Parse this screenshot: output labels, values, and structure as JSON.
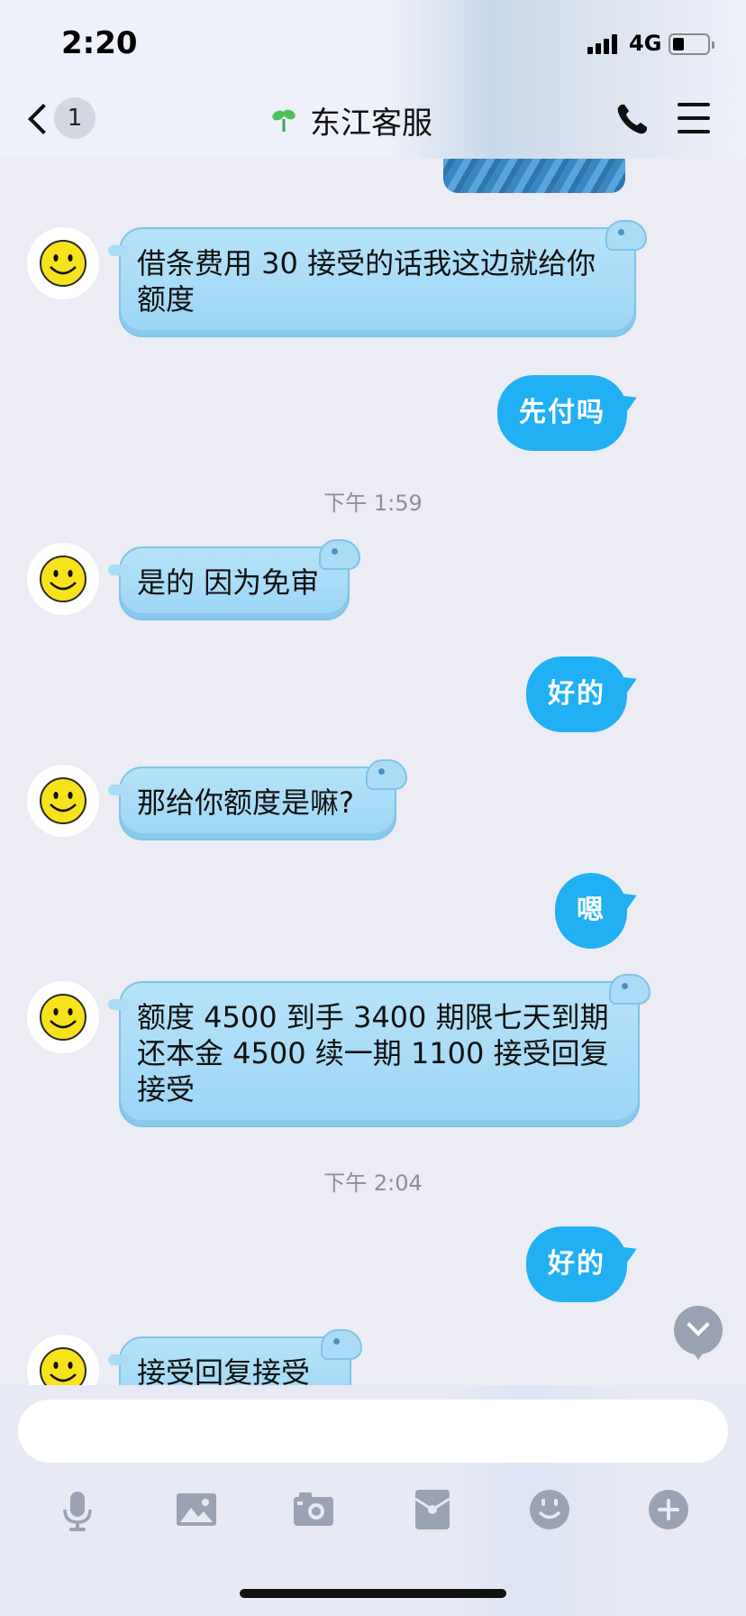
{
  "status_bar": {
    "time": "2:20",
    "network": "4G"
  },
  "nav": {
    "back_count": "1",
    "title": "东江客服"
  },
  "messages": [
    {
      "side": "in",
      "text_lines": [
        "借条费用 30 接受的话我这边就给你",
        "额度"
      ]
    },
    {
      "side": "out",
      "text": "先付吗"
    },
    {
      "type": "time",
      "text": "下午 1:59"
    },
    {
      "side": "in",
      "text_lines": [
        "是的 因为免审"
      ]
    },
    {
      "side": "out",
      "text": "好的"
    },
    {
      "side": "in",
      "text_lines": [
        "那给你额度是嘛?"
      ]
    },
    {
      "side": "out",
      "text": "嗯"
    },
    {
      "side": "in",
      "text_lines": [
        "额度 4500 到手 3400 期限七天到期",
        "还本金 4500 续一期 1100 接受回复",
        "接受"
      ]
    },
    {
      "type": "time",
      "text": "下午 2:04"
    },
    {
      "side": "out",
      "text": "好的"
    },
    {
      "side": "in",
      "text_lines": [
        "接受回复接受"
      ]
    }
  ],
  "input": {
    "placeholder": ""
  },
  "toolbar": [
    "microphone-icon",
    "image-icon",
    "camera-icon",
    "red-packet-icon",
    "emoji-icon",
    "plus-icon"
  ],
  "colors": {
    "incoming_bubble": "#aadcf7",
    "outgoing_bubble": "#21b0f4",
    "background": "#ebecf4"
  }
}
